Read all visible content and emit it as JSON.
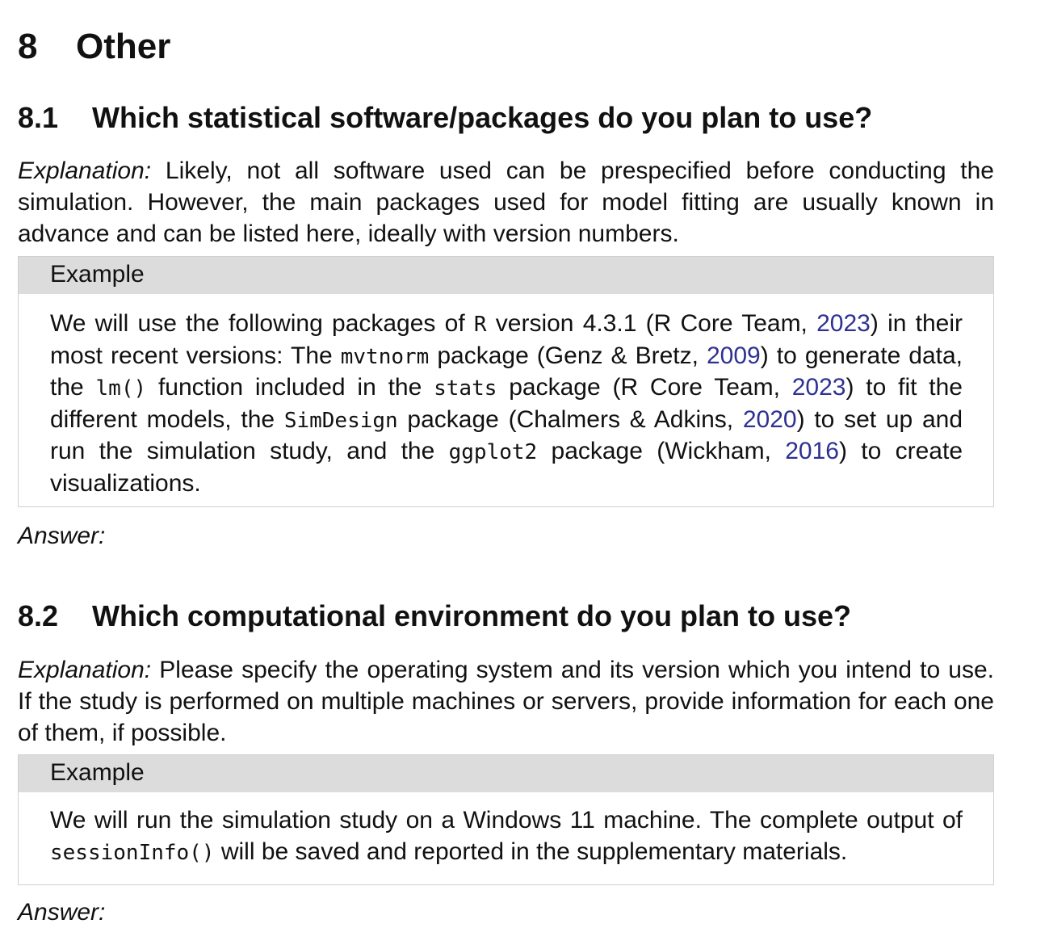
{
  "section": {
    "number": "8",
    "title": "Other"
  },
  "subsections": [
    {
      "number": "8.1",
      "title": "Which statistical software/packages do you plan to use?",
      "explanation_label": "Explanation:",
      "explanation_text": "Likely, not all software used can be prespecified before conducting the simulation.  However, the main packages used for model fitting are usually known in advance and can be listed here, ideally with version numbers.",
      "example_label": "Example",
      "example": {
        "t1": "We will use the following packages of ",
        "c1": "R",
        "t2": " version 4.3.1 (R Core Team, ",
        "y1": "2023",
        "t3": ") in their most recent versions:  The ",
        "c2": "mvtnorm",
        "t4": " package (Genz & Bretz, ",
        "y2": "2009",
        "t5": ") to generate data, the ",
        "c3": "lm()",
        "t6": " function included in the ",
        "c4": "stats",
        "t7": " package (R Core Team, ",
        "y3": "2023",
        "t8": ") to fit the different models, the ",
        "c5": "SimDesign",
        "t9": " package (Chalmers & Adkins, ",
        "y4": "2020",
        "t10": ") to set up and run the simulation study, and the ",
        "c6": "ggplot2",
        "t11": " package (Wickham, ",
        "y5": "2016",
        "t12": ") to create visualizations."
      },
      "answer_label": "Answer:"
    },
    {
      "number": "8.2",
      "title": "Which computational environment do you plan to use?",
      "explanation_label": "Explanation:",
      "explanation_text": "Please specify the operating system and its version which you intend to use. If the study is performed on multiple machines or servers, provide information for each one of them, if possible.",
      "example_label": "Example",
      "example": {
        "t1": "We will run the simulation study on a Windows 11 machine. The complete output of ",
        "c1": "sessionInfo()",
        "t2": " will be saved and reported in the supplementary materials."
      },
      "answer_label": "Answer:"
    }
  ],
  "colors": {
    "link": "#2e3192",
    "box_header": "#dcdcdc",
    "box_border": "#d0d0d0"
  }
}
